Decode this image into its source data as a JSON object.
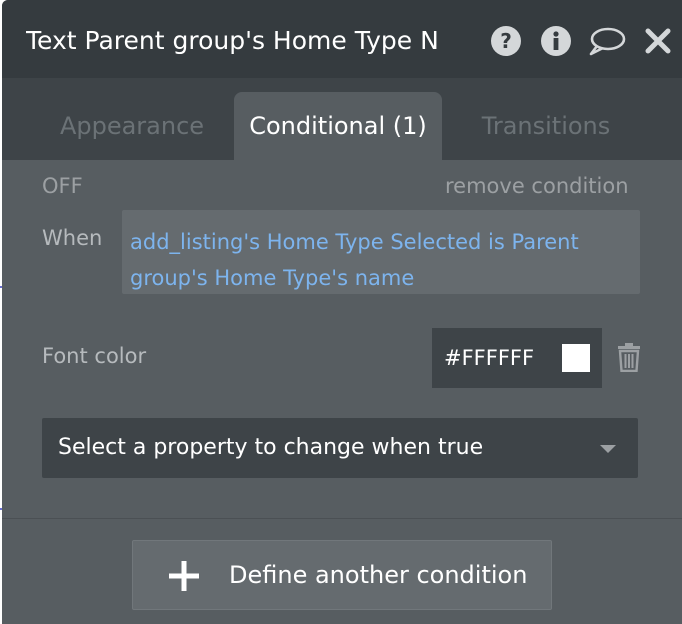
{
  "header": {
    "title": "Text Parent group's Home Type N",
    "icons": [
      "help-icon",
      "info-icon",
      "comment-icon",
      "close-icon"
    ]
  },
  "tabs": [
    {
      "label": "Appearance",
      "active": false
    },
    {
      "label": "Conditional (1)",
      "active": true
    },
    {
      "label": "Transitions",
      "active": false
    }
  ],
  "condition": {
    "toggle_label": "OFF",
    "remove_label": "remove condition",
    "when_label": "When",
    "expression": "add_listing's Home Type Selected is Parent group's Home Type's name"
  },
  "property": {
    "label": "Font color",
    "color_value": "#FFFFFF",
    "swatch_color": "#FFFFFF",
    "delete_icon": "trash-icon"
  },
  "select": {
    "placeholder": "Select a property to change when true",
    "caret_icon": "caret-down-icon"
  },
  "footer": {
    "define_label": "Define another condition",
    "plus_icon": "plus-icon"
  },
  "colors": {
    "header_bg": "#353B3F",
    "panel_bg": "#575D61",
    "link_blue": "#7DB4EE"
  }
}
